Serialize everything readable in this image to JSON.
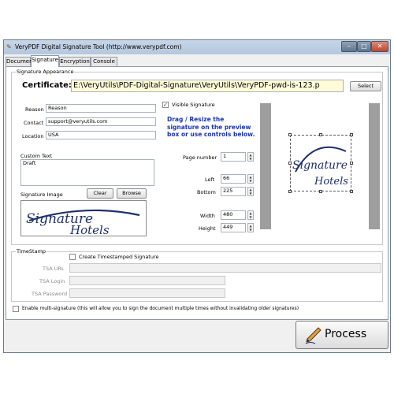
{
  "window": {
    "title": "VeryPDF Digital Signature Tool (http://www.verypdf.com)",
    "controls": {
      "minimize": "–",
      "maximize": "□",
      "close": "✕"
    }
  },
  "tabs": [
    {
      "label": "Document",
      "active": false
    },
    {
      "label": "Signature",
      "active": true
    },
    {
      "label": "Encryption",
      "active": false
    },
    {
      "label": "Console",
      "active": false
    }
  ],
  "appearance": {
    "group_label": "Signature Appearance",
    "certificate_label": "Certificate:",
    "certificate_value": "E:\\VeryUtils\\PDF-Digital-Signature\\VeryUtils\\VeryPDF-pwd-is-123.p",
    "select_button": "Select",
    "reason_label": "Reason",
    "reason_value": "Reason",
    "contact_label": "Contact",
    "contact_value": "support@veryutils.com",
    "location_label": "Location",
    "location_value": "USA",
    "custom_text_label": "Custom Text",
    "custom_text_value": "Draft",
    "signature_image_label": "Signature Image",
    "clear_button": "Clear",
    "browse_button": "Browse",
    "signature_image_text": [
      "Signature",
      "Hotels"
    ],
    "visible_signature_label": "Visible Signature",
    "visible_signature_checked": true,
    "hint": "Drag / Resize the signature on the preview box or use controls below.",
    "page_number_label": "Page number",
    "page_number": "1",
    "left_label": "Left",
    "left_value": "66",
    "bottom_label": "Bottom",
    "bottom_value": "225",
    "width_label": "Width",
    "width_value": "480",
    "height_label": "Height",
    "height_value": "449"
  },
  "timestamp": {
    "group_label": "TimeStamp",
    "create_label": "Create Timestamped Signature",
    "create_checked": false,
    "tsa_url_label": "TSA URL",
    "tsa_login_label": "TSA Login",
    "tsa_password_label": "TSA Password"
  },
  "multi_signature": {
    "label": "Enable multi-signature (this will allow you to sign the document multiple times without invalidating older signatures)",
    "checked": false
  },
  "process_button": "Process",
  "colors": {
    "hint_blue": "#1a35b5",
    "certificate_field_bg": "#fdfbd8",
    "signature_navy": "#1e2f6b",
    "preview_gray": "#9e9e9e"
  }
}
